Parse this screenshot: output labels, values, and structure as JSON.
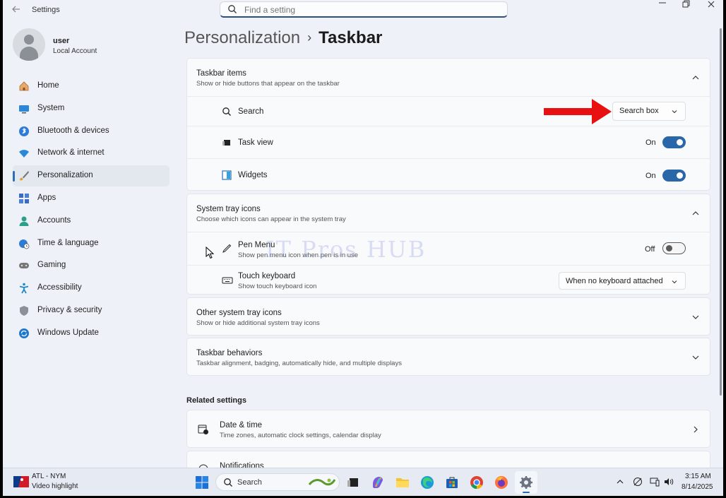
{
  "window": {
    "app_title": "Settings",
    "search_placeholder": "Find a setting"
  },
  "profile": {
    "name": "user",
    "account_type": "Local Account"
  },
  "sidebar": {
    "items": [
      {
        "label": "Home",
        "icon": "home-icon"
      },
      {
        "label": "System",
        "icon": "system-icon"
      },
      {
        "label": "Bluetooth & devices",
        "icon": "bluetooth-icon"
      },
      {
        "label": "Network & internet",
        "icon": "wifi-icon"
      },
      {
        "label": "Personalization",
        "icon": "brush-icon",
        "active": true
      },
      {
        "label": "Apps",
        "icon": "apps-icon"
      },
      {
        "label": "Accounts",
        "icon": "accounts-icon"
      },
      {
        "label": "Time & language",
        "icon": "globe-clock-icon"
      },
      {
        "label": "Gaming",
        "icon": "gamepad-icon"
      },
      {
        "label": "Accessibility",
        "icon": "accessibility-icon"
      },
      {
        "label": "Privacy & security",
        "icon": "shield-icon"
      },
      {
        "label": "Windows Update",
        "icon": "update-icon"
      }
    ]
  },
  "breadcrumb": {
    "parent": "Personalization",
    "separator": "›",
    "current": "Taskbar"
  },
  "taskbar_items": {
    "title": "Taskbar items",
    "description": "Show or hide buttons that appear on the taskbar",
    "search": {
      "label": "Search",
      "value": "Search box"
    },
    "task_view": {
      "label": "Task view",
      "state": "On"
    },
    "widgets": {
      "label": "Widgets",
      "state": "On"
    }
  },
  "system_tray": {
    "title": "System tray icons",
    "description": "Choose which icons can appear in the system tray",
    "pen_menu": {
      "label": "Pen Menu",
      "description": "Show pen menu icon when pen is in use",
      "state": "Off"
    },
    "touch_keyboard": {
      "label": "Touch keyboard",
      "description": "Show touch keyboard icon",
      "value": "When no keyboard attached"
    }
  },
  "other_tray": {
    "title": "Other system tray icons",
    "description": "Show or hide additional system tray icons"
  },
  "behaviors": {
    "title": "Taskbar behaviors",
    "description": "Taskbar alignment, badging, automatically hide, and multiple displays"
  },
  "related": {
    "heading": "Related settings",
    "date_time": {
      "title": "Date & time",
      "description": "Time zones, automatic clock settings, calendar display"
    },
    "notifications": {
      "title": "Notifications"
    }
  },
  "watermark": "IT Pros HUB",
  "taskbar": {
    "weather_title": "ATL - NYM",
    "weather_sub": "Video highlight",
    "search_label": "Search",
    "time": "3:15 AM",
    "date": "8/14/2025"
  },
  "colors": {
    "accent": "#2a67a8",
    "arrow": "#e81010"
  }
}
